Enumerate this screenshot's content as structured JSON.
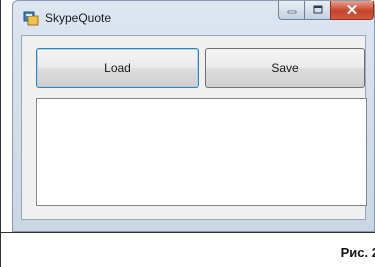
{
  "window": {
    "title": "SkypeQuote",
    "icon": "app-icon"
  },
  "caption_buttons": {
    "minimize_icon": "minimize-icon",
    "maximize_icon": "maximize-icon",
    "close_icon": "close-icon"
  },
  "toolbar": {
    "load_label": "Load",
    "save_label": "Save"
  },
  "textbox": {
    "value": ""
  },
  "figure": {
    "caption": "Рис. 2"
  },
  "colors": {
    "close_button": "#c7432c",
    "focused_button_border": "#3c7fb1",
    "client_background": "#f0f0f0"
  }
}
